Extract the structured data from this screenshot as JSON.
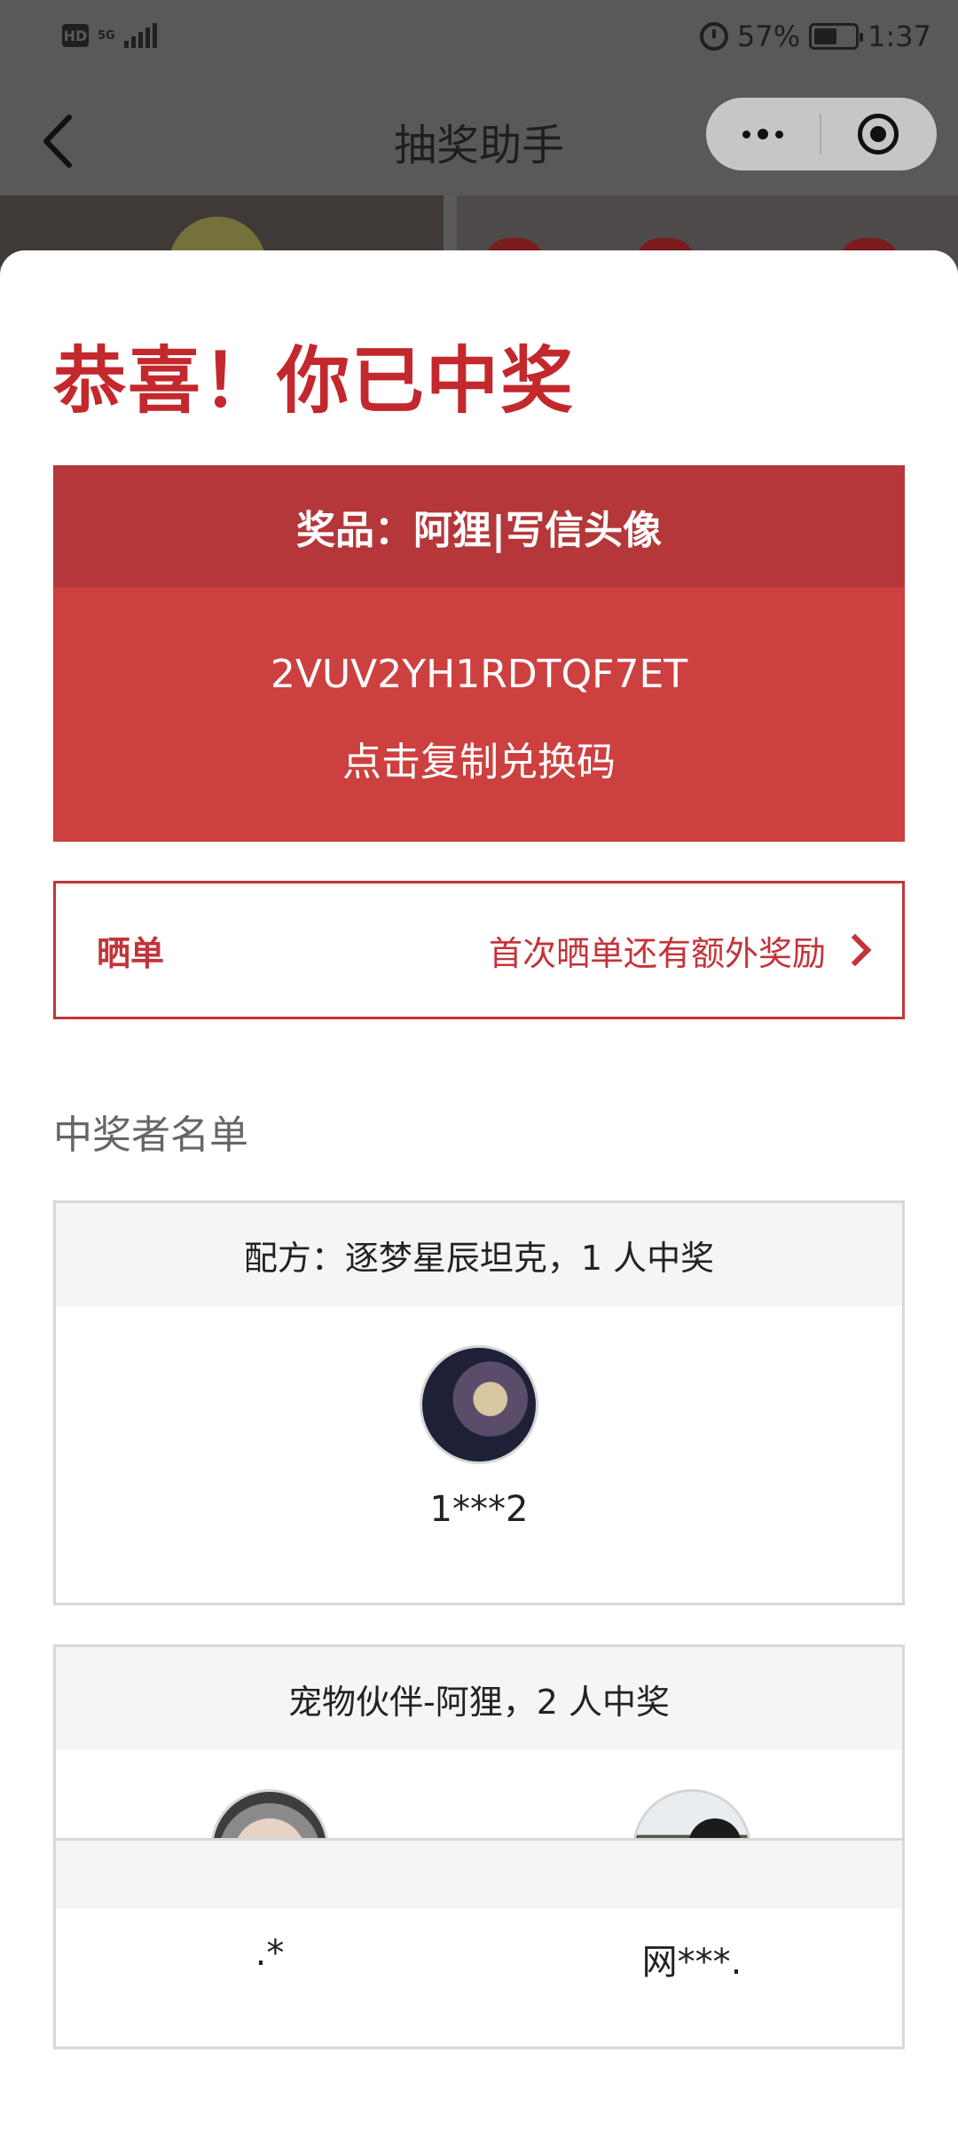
{
  "status_bar": {
    "network": "5G",
    "battery": "57%",
    "time": "1:37"
  },
  "nav": {
    "title": "抽奖助手"
  },
  "headline": "恭喜！你已中奖",
  "prize": {
    "title": "奖品：阿狸|写信头像",
    "code": "2VUV2YH1RDTQF7ET",
    "copy_action": "点击复制兑换码"
  },
  "share": {
    "label": "晒单",
    "hint": "首次晒单还有额外奖励"
  },
  "winners": {
    "title": "中奖者名单",
    "groups": [
      {
        "header": "配方：逐梦星辰坦克，1 人中奖",
        "winners": [
          {
            "name": "1***2"
          }
        ]
      },
      {
        "header": "宠物伙伴-阿狸，2 人中奖",
        "winners": [
          {
            "name": ".*"
          },
          {
            "name": "网***."
          }
        ]
      }
    ]
  },
  "colors": {
    "accent_red": "#c3282d",
    "prize_card": "#cc4140",
    "prize_header": "#b5373a"
  }
}
